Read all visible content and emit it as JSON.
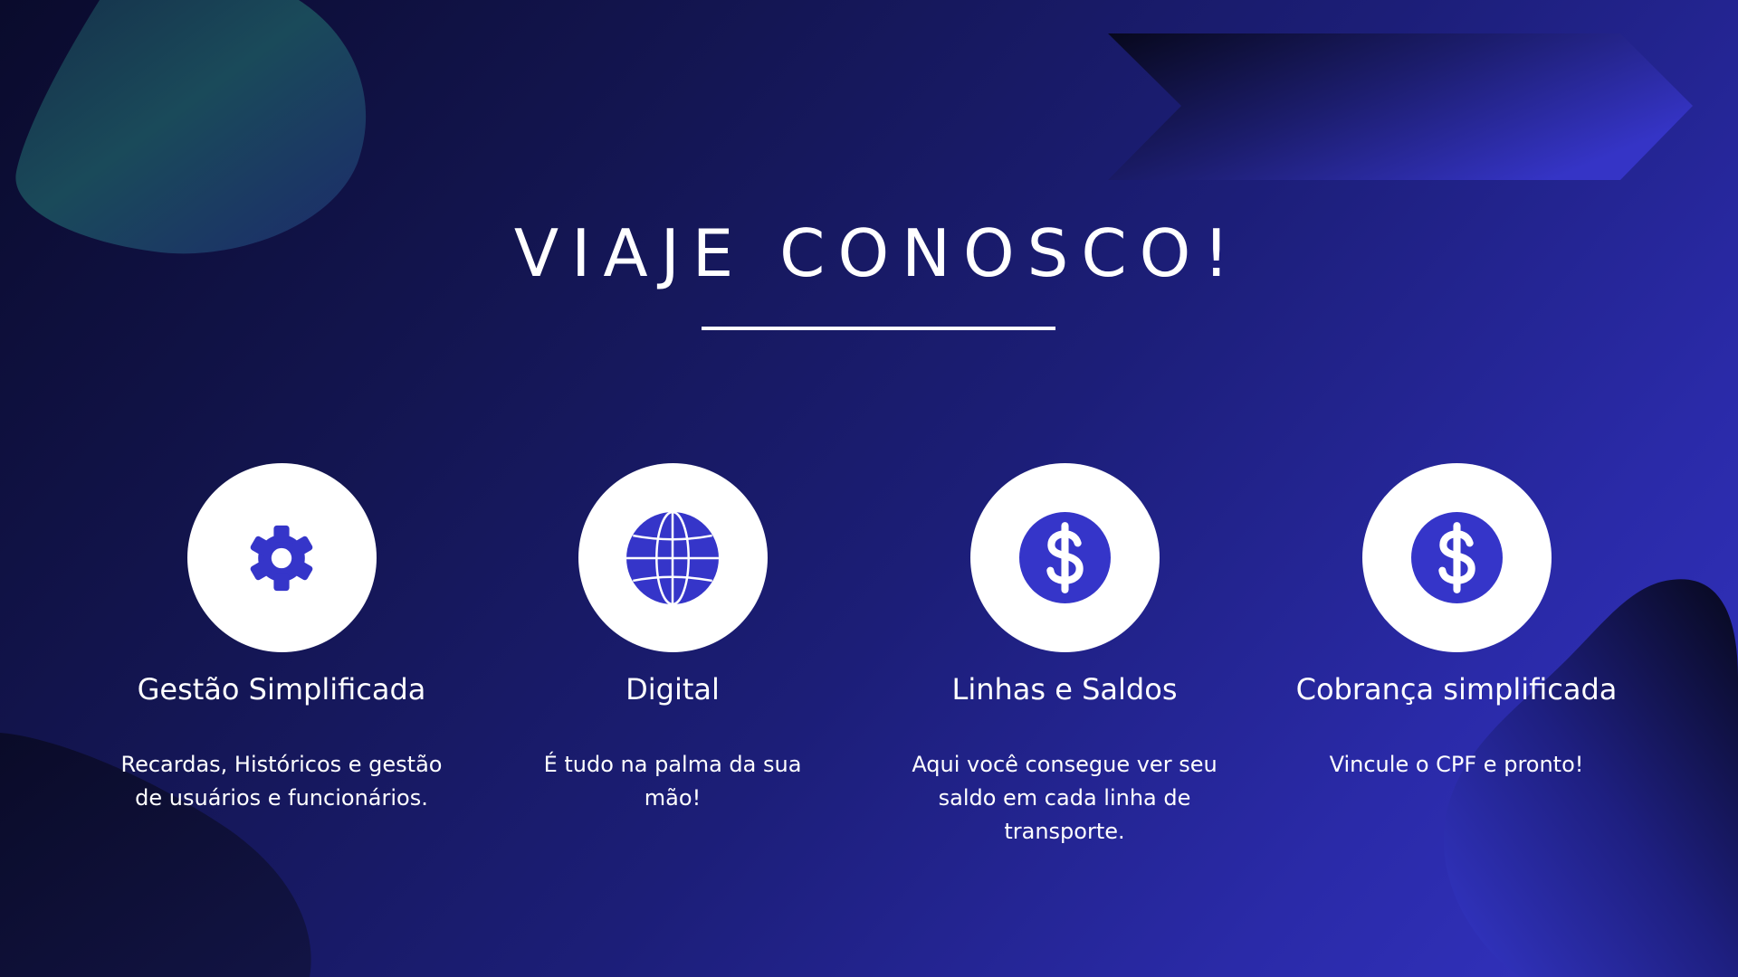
{
  "title": "VIAJE CONOSCO!",
  "colors": {
    "accent": "#3434c4",
    "background_dark": "#0a0b2c",
    "background_light": "#3434c4",
    "text": "#ffffff"
  },
  "features": [
    {
      "icon": "gear-icon",
      "title": "Gestão Simplificada",
      "description": "Recardas, Históricos e gestão de usuários e funcionários."
    },
    {
      "icon": "globe-icon",
      "title": "Digital",
      "description": "É tudo na palma da sua mão!"
    },
    {
      "icon": "dollar-icon",
      "title": "Linhas e Saldos",
      "description": "Aqui você consegue ver seu saldo em cada linha de transporte."
    },
    {
      "icon": "dollar-icon",
      "title": "Cobrança simplificada",
      "description": "Vincule o CPF e pronto!"
    }
  ]
}
